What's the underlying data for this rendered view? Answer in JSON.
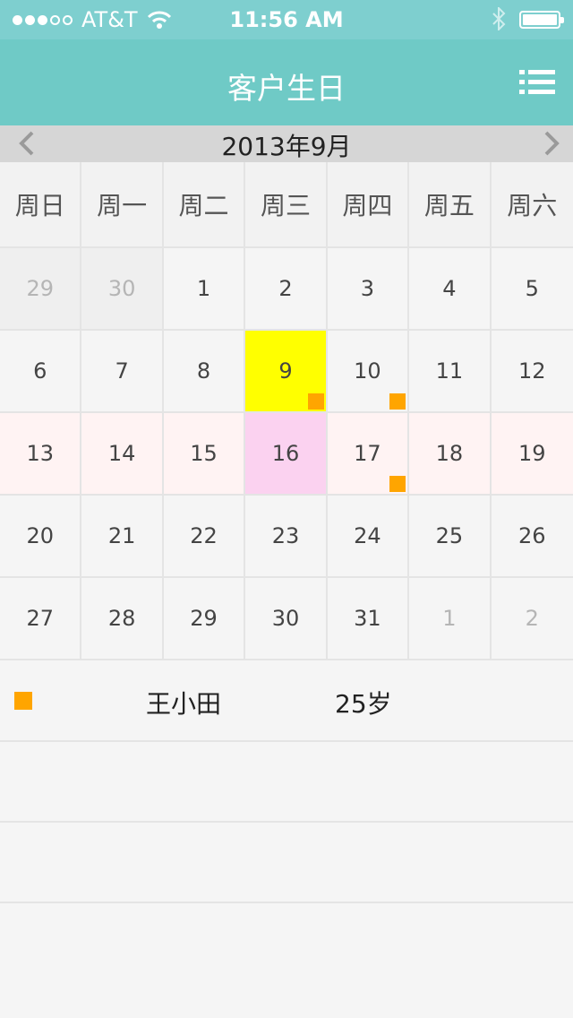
{
  "status_bar": {
    "carrier": "AT&T",
    "time": "11:56 AM"
  },
  "navbar": {
    "title": "客户生日"
  },
  "calendar": {
    "month_label": "2013年9月",
    "weekdays": [
      "周日",
      "周一",
      "周二",
      "周三",
      "周四",
      "周五",
      "周六"
    ],
    "days": [
      "29",
      "30",
      "1",
      "2",
      "3",
      "4",
      "5",
      "6",
      "7",
      "8",
      "9",
      "10",
      "11",
      "12",
      "13",
      "14",
      "15",
      "16",
      "17",
      "18",
      "19",
      "20",
      "21",
      "22",
      "23",
      "24",
      "25",
      "26",
      "27",
      "28",
      "29",
      "30",
      "31",
      "1",
      "2"
    ]
  },
  "birthday_list": [
    {
      "name": "王小田",
      "age": "25岁"
    }
  ],
  "colors": {
    "header": "#6fcac6",
    "marker": "#ffa500",
    "selected": "#ffff00",
    "today": "#fbd2f0"
  }
}
